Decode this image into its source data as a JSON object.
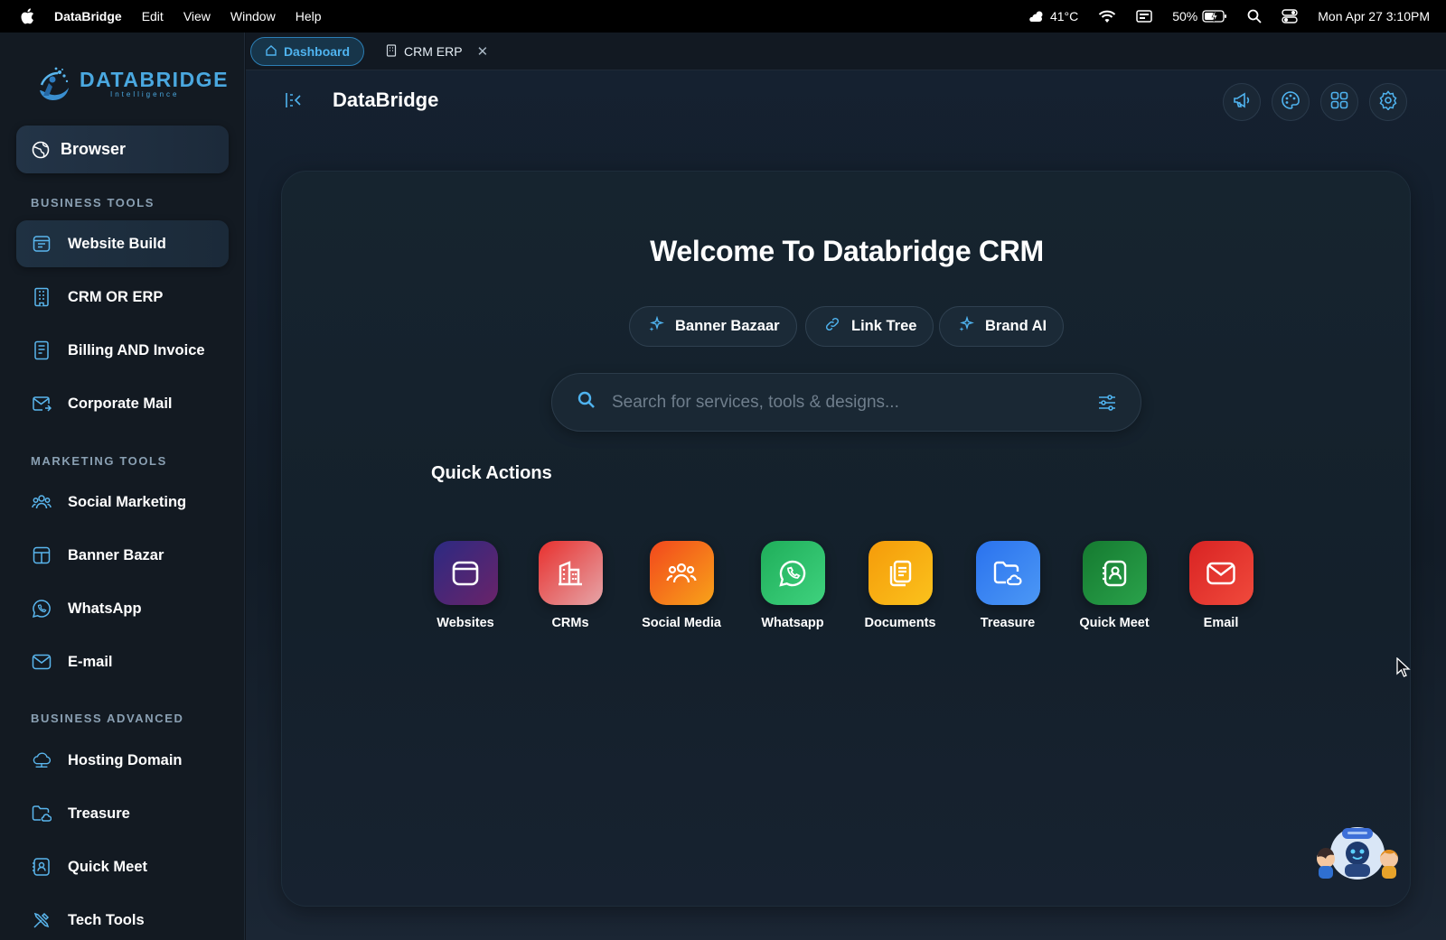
{
  "menubar": {
    "app_name": "DataBridge",
    "menus": [
      "Edit",
      "View",
      "Window",
      "Help"
    ],
    "weather": "41°C",
    "battery": "50%",
    "datetime": "Mon Apr 27  3:10PM"
  },
  "sidebar": {
    "logo_text": "DATABRIDGE",
    "logo_subtext": "Intelligence",
    "browser_label": "Browser",
    "sections": {
      "business_tools": "BUSINESS TOOLS",
      "marketing_tools": "MARKETING TOOLS",
      "business_advanced": "BUSINESS ADVANCED"
    },
    "items": [
      {
        "label": "Website Build",
        "icon": "website-icon",
        "active": true
      },
      {
        "label": "CRM OR ERP",
        "icon": "building-icon"
      },
      {
        "label": "Billing AND  Invoice",
        "icon": "invoice-icon"
      },
      {
        "label": "Corporate Mail",
        "icon": "mail-icon"
      },
      {
        "label": "Social Marketing",
        "icon": "users-icon"
      },
      {
        "label": "Banner Bazar",
        "icon": "banner-icon"
      },
      {
        "label": "WhatsApp",
        "icon": "whatsapp-icon"
      },
      {
        "label": "E-mail",
        "icon": "envelope-icon"
      },
      {
        "label": "Hosting Domain",
        "icon": "cloud-icon"
      },
      {
        "label": "Treasure",
        "icon": "folder-cloud-icon"
      },
      {
        "label": "Quick Meet",
        "icon": "contact-icon"
      },
      {
        "label": "Tech Tools",
        "icon": "tools-icon"
      }
    ]
  },
  "tabs": [
    {
      "label": "Dashboard",
      "active": true
    },
    {
      "label": "CRM ERP",
      "active": false
    }
  ],
  "header": {
    "title": "DataBridge"
  },
  "main": {
    "welcome": "Welcome To Databridge CRM",
    "chips": [
      "Banner Bazaar",
      "Link Tree",
      "Brand AI"
    ],
    "search_placeholder": "Search for services, tools & designs...",
    "quick_actions_title": "Quick Actions",
    "quick_actions": [
      {
        "label": "Websites",
        "color": "#4a2a7a"
      },
      {
        "label": "CRMs",
        "color": "#e0393c"
      },
      {
        "label": "Social Media",
        "color": "#f26a1b"
      },
      {
        "label": "Whatsapp",
        "color": "#22b864"
      },
      {
        "label": "Documents",
        "color": "#f5a50b"
      },
      {
        "label": "Treasure",
        "color": "#2f7ff0"
      },
      {
        "label": "Quick Meet",
        "color": "#1e8a3a"
      },
      {
        "label": "Email",
        "color": "#e3342e"
      }
    ]
  },
  "colors": {
    "accent": "#4fb3ef",
    "sidebar_bg": "#131a22",
    "panel_bg": "#16242f"
  }
}
